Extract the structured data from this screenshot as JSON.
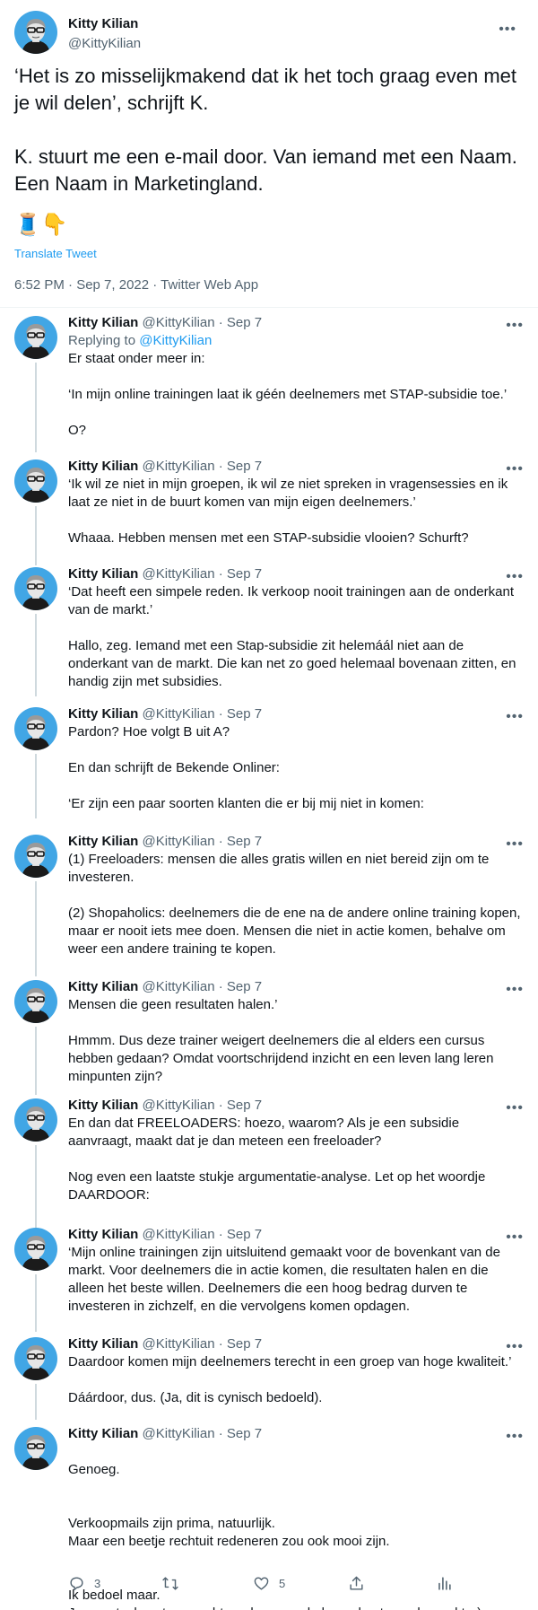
{
  "main_tweet": {
    "author_name": "Kitty Kilian",
    "author_handle": "@KittyKilian",
    "paragraphs": [
      "‘Het is zo misselijkmakend dat ik het toch graag even met je wil delen’, schrijft K.",
      "K. stuurt me een e-mail door. Van iemand met een Naam. Een Naam in Marketingland."
    ],
    "emojis": "🧵👇",
    "translate_label": "Translate Tweet",
    "timestamp": "6:52 PM · Sep 7, 2022 · Twitter Web App"
  },
  "replies": [
    {
      "name": "Kitty Kilian",
      "handle_date": "@KittyKilian · Sep 7",
      "replying_prefix": "Replying to",
      "replying_mention": "@KittyKilian",
      "paragraphs": [
        "Er staat onder meer in:",
        "‘In mijn online trainingen laat ik géén deelnemers met STAP-subsidie toe.’",
        "O?"
      ]
    },
    {
      "name": "Kitty Kilian",
      "handle_date": "@KittyKilian · Sep 7",
      "paragraphs": [
        "‘Ik wil ze niet in mijn groepen, ik wil ze niet spreken in vragensessies en ik laat ze niet in de buurt komen van mijn eigen deelnemers.’",
        "Whaaa. Hebben mensen met een STAP-subsidie vlooien? Schurft?"
      ]
    },
    {
      "name": "Kitty Kilian",
      "handle_date": "@KittyKilian · Sep 7",
      "paragraphs": [
        "‘Dat heeft een simpele reden. Ik verkoop nooit trainingen aan de onderkant van de markt.’",
        "Hallo, zeg. Iemand met een Stap-subsidie zit helemáál niet aan de onderkant van de markt. Die kan net zo goed helemaal bovenaan zitten, en handig zijn met subsidies."
      ]
    },
    {
      "name": "Kitty Kilian",
      "handle_date": "@KittyKilian · Sep 7",
      "paragraphs": [
        "Pardon? Hoe volgt B uit A?",
        "En dan schrijft de Bekende Onliner:",
        "‘Er zijn een paar soorten klanten die er bij mij niet in komen:"
      ]
    },
    {
      "name": "Kitty Kilian",
      "handle_date": "@KittyKilian · Sep 7",
      "paragraphs": [
        "(1) Freeloaders: mensen die alles gratis willen en niet bereid zijn om te investeren.",
        "(2) Shopaholics: deelnemers die de ene na de andere online training kopen, maar er nooit iets mee doen. Mensen die niet in actie komen, behalve om weer een andere training te kopen."
      ]
    },
    {
      "name": "Kitty Kilian",
      "handle_date": "@KittyKilian · Sep 7",
      "paragraphs": [
        "Mensen die geen resultaten halen.’",
        "Hmmm. Dus deze trainer weigert deelnemers die al elders een cursus hebben gedaan? Omdat voortschrijdend inzicht en een leven lang leren minpunten zijn?"
      ]
    },
    {
      "name": "Kitty Kilian",
      "handle_date": "@KittyKilian · Sep 7",
      "paragraphs": [
        "En dan dat FREELOADERS: hoezo, waarom? Als je een subsidie aanvraagt, maakt dat je dan meteen een freeloader?",
        "Nog even een laatste stukje argumentatie-analyse. Let op het woordje DAARDOOR:"
      ]
    },
    {
      "name": "Kitty Kilian",
      "handle_date": "@KittyKilian · Sep 7",
      "paragraphs": [
        "‘Mijn online trainingen zijn uitsluitend gemaakt voor de bovenkant van de markt. Voor deelnemers die in actie komen, die resultaten halen en die alleen het beste willen. Deelnemers die een hoog bedrag durven te investeren in zichzelf, en die vervolgens komen opdagen."
      ]
    },
    {
      "name": "Kitty Kilian",
      "handle_date": "@KittyKilian · Sep 7",
      "paragraphs": [
        "Daardoor komen mijn deelnemers terecht in een groep van hoge kwaliteit.’",
        "Dáárdoor, dus. (Ja, dit is cynisch bedoeld)."
      ]
    },
    {
      "name": "Kitty Kilian",
      "handle_date": "@KittyKilian · Sep 7",
      "paragraphs": [
        "Genoeg.",
        "Verkoopmails zijn prima, natuurlijk.\nMaar een beetje rechtuit redeneren zou ook mooi zijn.",
        "Ik bedoel maar.\nJe mag toch wat verwachten, daar aan de bovenkant van de markt ;-)"
      ]
    }
  ],
  "actions": {
    "reply_count": "3",
    "retweet_count": "",
    "like_count": "5"
  },
  "colors": {
    "accent": "#1d9bf0",
    "secondary_text": "#536471",
    "avatar_bg": "#41a6e5",
    "thread_line": "#cfd9de"
  }
}
